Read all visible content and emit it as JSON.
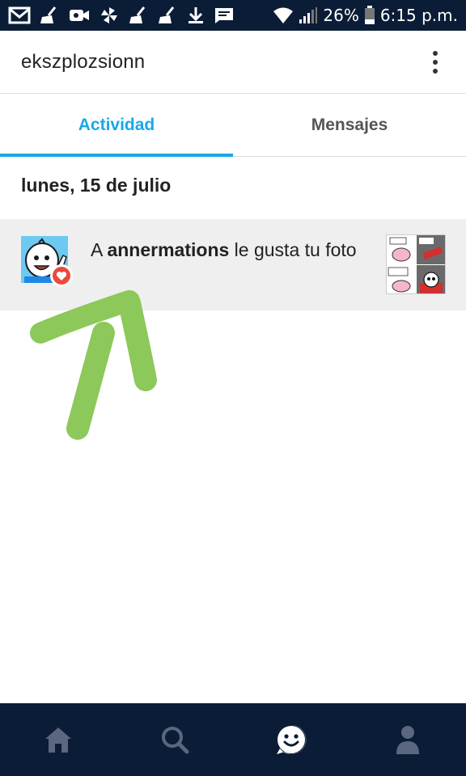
{
  "status_bar": {
    "battery": "26%",
    "time": "6:15 p.m."
  },
  "header": {
    "title": "ekszplozsionn"
  },
  "tabs": [
    {
      "label": "Actividad",
      "active": true
    },
    {
      "label": "Mensajes",
      "active": false
    }
  ],
  "activity": {
    "date": "lunes, 15 de julio",
    "items": [
      {
        "prefix": "A ",
        "user": "annermations",
        "suffix": " le gusta tu foto"
      }
    ]
  },
  "colors": {
    "accent": "#18a9e6",
    "nav_bg": "#0b1d36",
    "heart": "#ea4a3a",
    "annotation": "#8cc85a"
  },
  "icons": {
    "status": [
      "gmail-icon",
      "broom-icon",
      "video-camera-icon",
      "pinwheel-icon",
      "broom-icon",
      "broom-icon",
      "download-icon",
      "message-icon",
      "wifi-icon",
      "signal-icon",
      "battery-icon"
    ],
    "nav": [
      "home-icon",
      "search-icon",
      "activity-icon",
      "profile-icon"
    ]
  }
}
